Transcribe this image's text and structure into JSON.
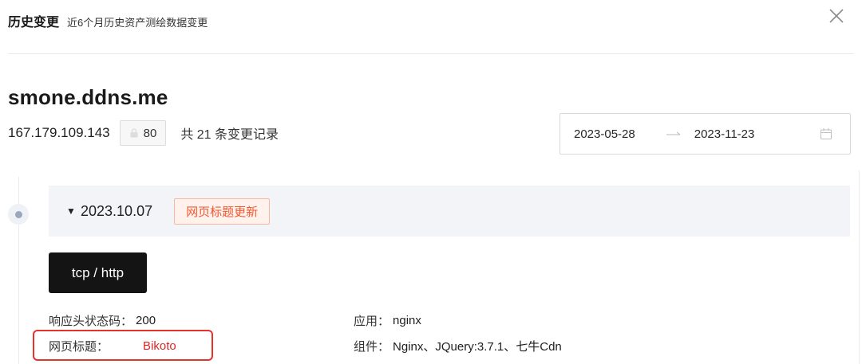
{
  "header": {
    "title": "历史变更",
    "subtitle": "近6个月历史资产测绘数据变更"
  },
  "asset": {
    "domain": "smone.ddns.me",
    "ip": "167.179.109.143",
    "port": "80",
    "record_count_text": "共 21 条变更记录"
  },
  "date_range": {
    "start": "2023-05-28",
    "end": "2023-11-23"
  },
  "entry": {
    "date": "2023.10.07",
    "toggle": "▼",
    "change_tag": "网页标题更新",
    "protocol": "tcp / http",
    "fields": {
      "status_label": "响应头状态码：",
      "status_value": "200",
      "title_label": "网页标题：",
      "title_value": "Bikoto",
      "app_label": "应用：",
      "app_value": "nginx",
      "component_label": "组件：",
      "component_value": "Nginx、JQuery:3.7.1、七牛Cdn"
    }
  },
  "colors": {
    "accent_red": "#e02424",
    "tag_orange": "#f2582f",
    "highlight_border": "#e8312b"
  }
}
